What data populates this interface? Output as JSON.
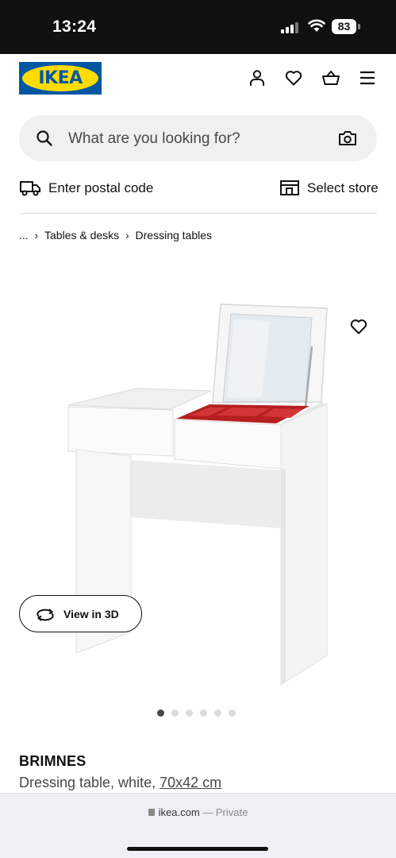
{
  "status_bar": {
    "time": "13:24",
    "battery": "83"
  },
  "header": {
    "logo_text": "IKEA",
    "brand_blue": "#0058a3",
    "brand_yellow": "#ffdb00",
    "icons": [
      "profile-icon",
      "heart-icon",
      "basket-icon",
      "menu-icon"
    ]
  },
  "search": {
    "placeholder": "What are you looking for?"
  },
  "delivery": {
    "postal_label": "Enter postal code",
    "store_label": "Select store"
  },
  "breadcrumb": {
    "items": [
      "...",
      "Tables & desks",
      "Dressing tables"
    ]
  },
  "gallery": {
    "view3d_label": "View in 3D",
    "dot_count": 6,
    "active_dot": 1
  },
  "product": {
    "name": "BRIMNES",
    "description": "Dressing table, white, ",
    "size": "70x42 cm"
  },
  "browser": {
    "domain": "ikea.com",
    "separator": " — ",
    "mode": "Private"
  }
}
